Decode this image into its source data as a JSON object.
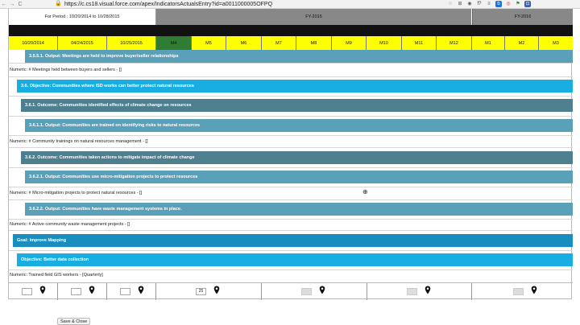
{
  "browser": {
    "url": "https://c.cs18.visual.force.com/apex/IndicatorsActualsEntry?id=a0011000005OFPQ",
    "nav_back": "←",
    "nav_forward": "→",
    "nav_reload": "C",
    "lock_icon": "lock-icon",
    "extensions": [
      "☆",
      "⊞",
      "◉",
      "f?",
      "≡",
      "b",
      "◎",
      "⚑",
      "⊡"
    ]
  },
  "header": {
    "period": "For Period : 10/20/2014 to 10/28/2015",
    "fy2015": "FY-2015",
    "fy2016": "FY-2016"
  },
  "columns": [
    {
      "label": "10/20/2014",
      "current": false
    },
    {
      "label": "04/24/2015",
      "current": false
    },
    {
      "label": "10/25/2015",
      "current": false
    },
    {
      "label": "M4",
      "current": true
    },
    {
      "label": "M5",
      "current": false
    },
    {
      "label": "M6",
      "current": false
    },
    {
      "label": "M7",
      "current": false
    },
    {
      "label": "M8",
      "current": false
    },
    {
      "label": "M9",
      "current": false
    },
    {
      "label": "M10",
      "current": false
    },
    {
      "label": "M11",
      "current": false
    },
    {
      "label": "M12",
      "current": false
    },
    {
      "label": "M1",
      "current": false
    },
    {
      "label": "M2",
      "current": false
    },
    {
      "label": "M3",
      "current": false
    }
  ],
  "rows": {
    "r1": "3.5.5.1. Output: Meetings are held to improve buyer/seller relationships",
    "r2": "Numeric: # Meetings held between buyers and sellers - []",
    "r3": "3.6. Objective: Communities where ISD works can better protect natural resources",
    "r4": "3.6.1. Outcome: Communities identified effects of climate change on resources",
    "r5": "3.6.1.1. Output: Communities are trained on identifying risks to natural resources",
    "r6": "Numeric: # Community trainings on natural resources management - []",
    "r7": "3.6.2. Outcome: Communities taken actions to mitigate impact of climate change",
    "r8": "3.6.2.1. Output: Communities use micro-mitigation projects to protect resources",
    "r9": "Numeric: # Micro-mitigation projects to protect natural resources - []",
    "r10": "3.6.2.2. Output: Communities have waste management systems in place.",
    "r11": "Numeric: # Active community waste management projects - []",
    "r12": "Goal: Improve Mapping",
    "r13": "Objective: Better data collection",
    "r14": "Numeric: Trained field GIS workers - [Quarterly]"
  },
  "entry_values": {
    "m4_value": "25"
  },
  "actions": {
    "save_close": "Save & Close"
  },
  "colors": {
    "month_header": "#ffff00",
    "current_month": "#2e7d32",
    "output_bar": "#5aa0b8",
    "outcome_bar": "#4d7f8e",
    "objective_bar": "#19aee2",
    "goal_bar": "#1a8dbf"
  }
}
